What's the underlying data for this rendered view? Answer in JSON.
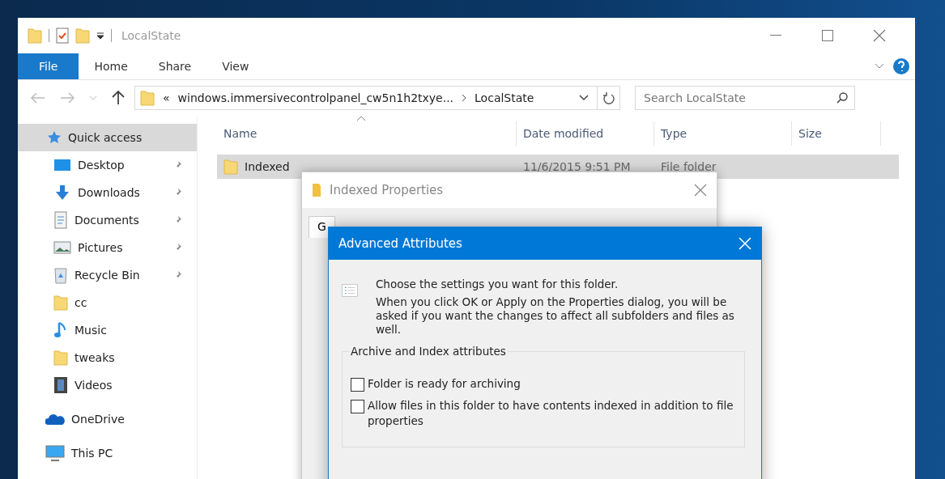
{
  "explorer": {
    "title": "LocalState",
    "ribbon_tabs": [
      {
        "label": "File",
        "selected": true
      },
      {
        "label": "Home",
        "selected": false
      },
      {
        "label": "Share",
        "selected": false
      },
      {
        "label": "View",
        "selected": false
      }
    ],
    "address": {
      "prefix": "«",
      "segments": [
        "windows.immersivecontrolpanel_cw5n1h2txye...",
        "LocalState"
      ]
    },
    "search": {
      "placeholder": "Search LocalState"
    },
    "sidebar": [
      {
        "label": "Quick access",
        "kind": "star",
        "selected": true,
        "pinned": false
      },
      {
        "label": "Desktop",
        "kind": "desktop",
        "selected": false,
        "pinned": true
      },
      {
        "label": "Downloads",
        "kind": "download",
        "selected": false,
        "pinned": true
      },
      {
        "label": "Documents",
        "kind": "document",
        "selected": false,
        "pinned": true
      },
      {
        "label": "Pictures",
        "kind": "picture",
        "selected": false,
        "pinned": true
      },
      {
        "label": "Recycle Bin",
        "kind": "recycle",
        "selected": false,
        "pinned": true
      },
      {
        "label": "cc",
        "kind": "folder",
        "selected": false,
        "pinned": false
      },
      {
        "label": "Music",
        "kind": "music",
        "selected": false,
        "pinned": false
      },
      {
        "label": "tweaks",
        "kind": "folder",
        "selected": false,
        "pinned": false
      },
      {
        "label": "Videos",
        "kind": "video",
        "selected": false,
        "pinned": false
      },
      {
        "label": "OneDrive",
        "kind": "cloud",
        "selected": false,
        "pinned": false
      },
      {
        "label": "This PC",
        "kind": "pc",
        "selected": false,
        "pinned": false
      }
    ],
    "columns": [
      "Name",
      "Date modified",
      "Type",
      "Size"
    ],
    "rows": [
      {
        "name": "Indexed",
        "date_modified": "11/6/2015 9:51 PM",
        "type": "File folder",
        "selected": true
      }
    ]
  },
  "properties_dialog": {
    "title": "Indexed Properties",
    "tabs": [
      {
        "label": "G",
        "selected": true
      }
    ]
  },
  "advanced_attributes": {
    "title": "Advanced Attributes",
    "intro": "Choose the settings you want for this folder.",
    "note": "When you click OK or Apply on the Properties dialog, you will be asked if you want the changes to affect all subfolders and files as well.",
    "group": "Archive and Index attributes",
    "options": [
      {
        "label": "Folder is ready for archiving",
        "checked": false
      },
      {
        "label": "Allow files in this folder to have contents indexed in addition to file properties",
        "checked": false
      }
    ]
  }
}
